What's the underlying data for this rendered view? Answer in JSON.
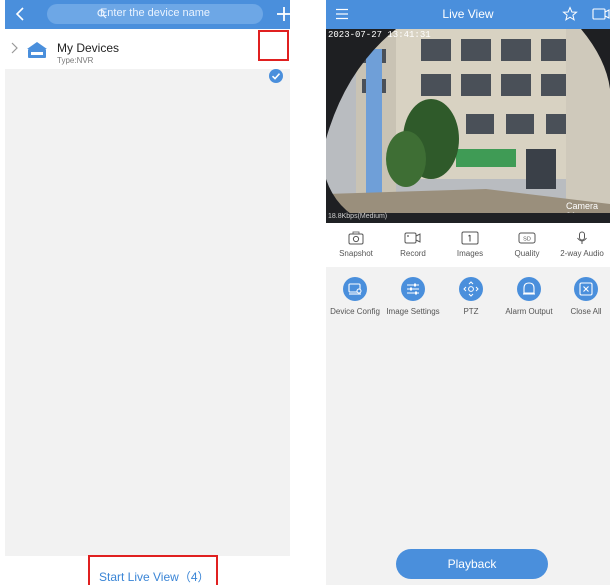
{
  "left": {
    "search_placeholder": "Enter the device name",
    "device": {
      "name": "My Devices",
      "type": "Type:NVR"
    },
    "start_live_label": "Start Live View（4）"
  },
  "right": {
    "title": "Live View",
    "osd_timestamp": "2023-07-27 13:41:31",
    "osd_camera": "Camera 01",
    "bitrate": "18.8Kbps(Medium)",
    "toolbar": [
      {
        "label": "Snapshot",
        "icon": "camera-icon"
      },
      {
        "label": "Record",
        "icon": "video-record-icon"
      },
      {
        "label": "Images",
        "icon": "images-icon"
      },
      {
        "label": "Quality",
        "icon": "sd-quality-icon"
      },
      {
        "label": "2-way Audio",
        "icon": "microphone-icon"
      }
    ],
    "functions": [
      {
        "label": "Device Config",
        "icon": "device-config-icon"
      },
      {
        "label": "Image Settings",
        "icon": "sliders-icon"
      },
      {
        "label": "PTZ",
        "icon": "ptz-icon"
      },
      {
        "label": "Alarm Output",
        "icon": "alarm-bell-icon"
      },
      {
        "label": "Close All",
        "icon": "close-all-icon"
      }
    ],
    "playback_label": "Playback"
  },
  "colors": {
    "accent": "#4a8fdc",
    "highlight_box": "#e02020",
    "background": "#f2f2f2"
  }
}
